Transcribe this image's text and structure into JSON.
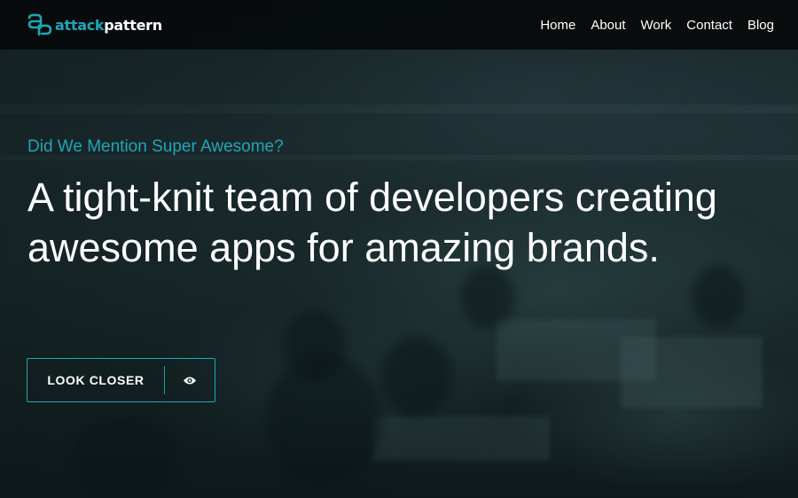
{
  "brand": {
    "logo_part1": "attack",
    "logo_part2": "pattern",
    "accent_color": "#1fa6b8"
  },
  "nav": {
    "items": [
      {
        "label": "Home"
      },
      {
        "label": "About"
      },
      {
        "label": "Work"
      },
      {
        "label": "Contact"
      },
      {
        "label": "Blog"
      }
    ]
  },
  "hero": {
    "kicker": "Did We Mention Super Awesome?",
    "headline": "A tight-knit team of developers creating awesome apps for amazing brands.",
    "cta_label": "LOOK CLOSER",
    "cta_icon": "eye-icon"
  }
}
